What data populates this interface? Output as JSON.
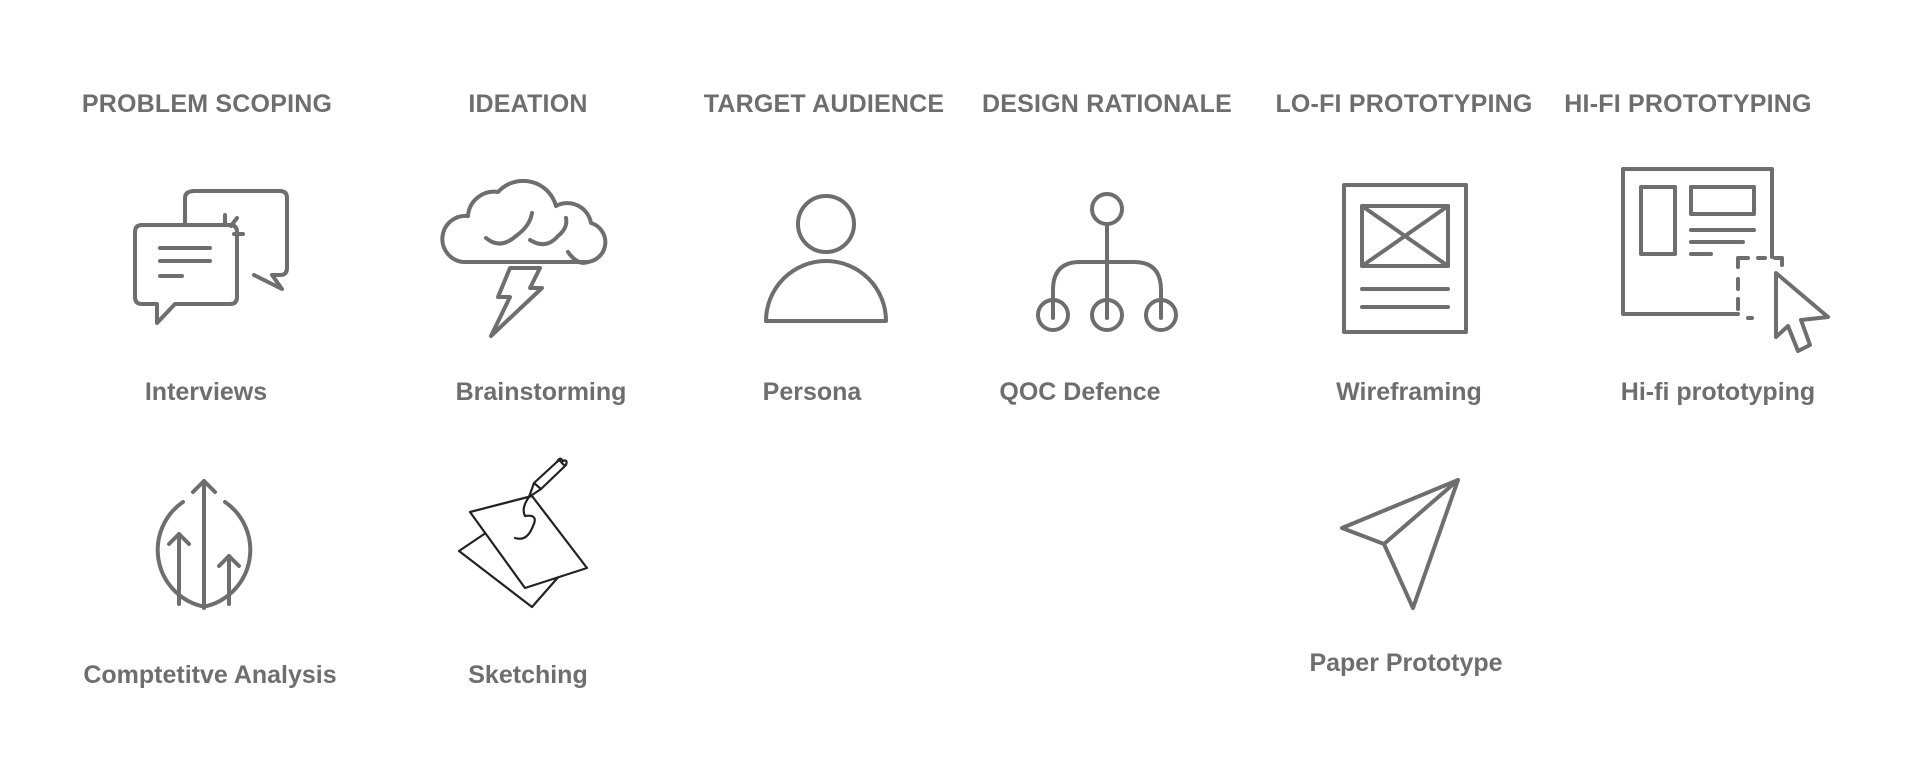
{
  "colors": {
    "text": "#6e6e6e",
    "icon_stroke": "#6e6e6e",
    "sketch_stroke": "#222222",
    "background": "#ffffff"
  },
  "columns": [
    {
      "heading": "PROBLEM SCOPING",
      "items": [
        {
          "label": "Interviews",
          "icon": "speech-bubbles-icon"
        },
        {
          "label": "Comptetitve Analysis",
          "icon": "growth-arrows-icon"
        }
      ]
    },
    {
      "heading": "IDEATION",
      "items": [
        {
          "label": "Brainstorming",
          "icon": "storm-cloud-icon"
        },
        {
          "label": "Sketching",
          "icon": "pencil-sketch-icon"
        }
      ]
    },
    {
      "heading": "TARGET AUDIENCE",
      "items": [
        {
          "label": "Persona",
          "icon": "person-icon"
        }
      ]
    },
    {
      "heading": "DESIGN RATIONALE",
      "items": [
        {
          "label": "QOC Defence",
          "icon": "hierarchy-tree-icon"
        }
      ]
    },
    {
      "heading": "LO-FI PROTOTYPING",
      "items": [
        {
          "label": "Wireframing",
          "icon": "wireframe-page-icon"
        },
        {
          "label": "Paper Prototype",
          "icon": "paper-plane-icon"
        }
      ]
    },
    {
      "heading": "HI-FI PROTOTYPING",
      "items": [
        {
          "label": "Hi-fi prototyping",
          "icon": "layout-cursor-icon"
        }
      ]
    }
  ]
}
